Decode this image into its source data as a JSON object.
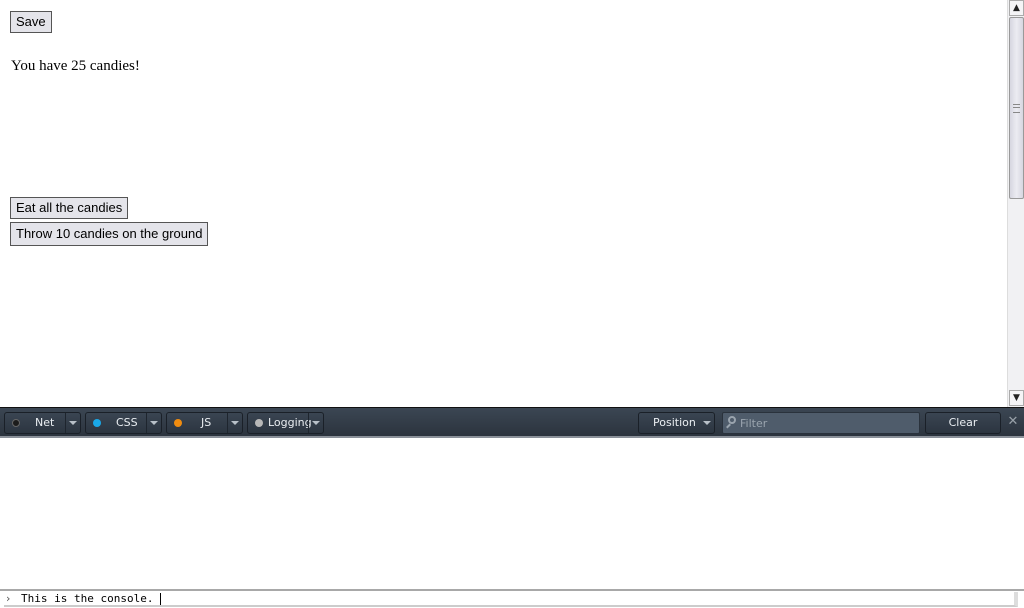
{
  "page": {
    "save_label": "Save",
    "candies_text": "You have 25 candies!",
    "candies_count": 25,
    "eat_label": "Eat all the candies",
    "throw_label": "Throw 10 candies on the ground"
  },
  "scrollbar": {
    "up_icon": "chevron-up-icon",
    "down_icon": "chevron-down-icon",
    "up_glyph": "▲",
    "down_glyph": "▼"
  },
  "devtools": {
    "toolbar": {
      "groups": [
        {
          "label": "Net",
          "dot_color": "#1c1c1c"
        },
        {
          "label": "CSS",
          "dot_color": "#1aa8e8"
        },
        {
          "label": "JS",
          "dot_color": "#f08c10"
        },
        {
          "label": "Logging",
          "dot_color": "#b8b8b8"
        }
      ],
      "position_label": "Position",
      "filter_placeholder": "Filter",
      "filter_value": "",
      "clear_label": "Clear",
      "close_glyph": "✕"
    },
    "console": {
      "prompt_glyph": "›",
      "input_text": "This is the console. "
    }
  }
}
